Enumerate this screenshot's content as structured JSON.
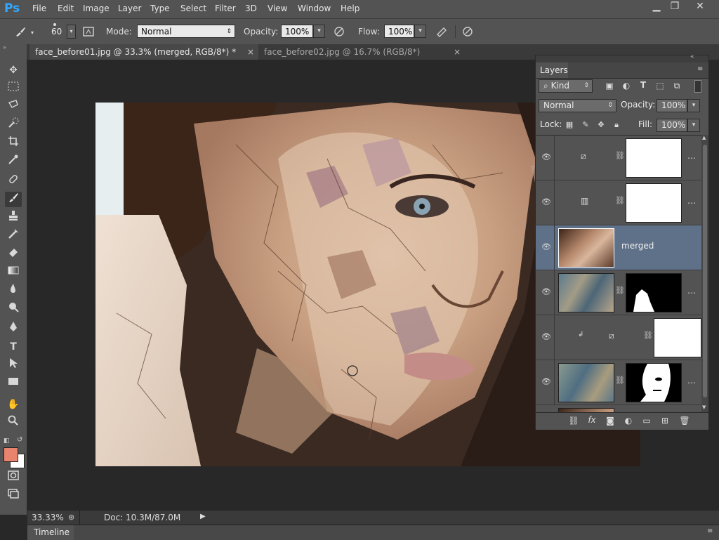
{
  "app": {
    "logo": "Ps"
  },
  "menu": [
    "File",
    "Edit",
    "Image",
    "Layer",
    "Type",
    "Select",
    "Filter",
    "3D",
    "View",
    "Window",
    "Help"
  ],
  "window_controls": {
    "minimize": "▁",
    "restore": "❐",
    "close": "✕"
  },
  "options": {
    "brush_size": "60",
    "mode_label": "Mode:",
    "mode_value": "Normal",
    "opacity_label": "Opacity:",
    "opacity_value": "100%",
    "flow_label": "Flow:",
    "flow_value": "100%"
  },
  "tabs": [
    {
      "label": "face_before01.jpg @ 33.3% (merged, RGB/8*) *",
      "close": "×",
      "active": true
    },
    {
      "label": "face_before02.jpg @ 16.7% (RGB/8*)",
      "close": "×",
      "active": false
    }
  ],
  "status": {
    "zoom": "33.33%",
    "doc": "Doc: 10.3M/87.0M"
  },
  "timeline": {
    "label": "Timeline"
  },
  "layers_panel": {
    "title": "Layers",
    "kind_label": "Kind",
    "blend_mode": "Normal",
    "opacity_label": "Opacity:",
    "opacity_value": "100%",
    "lock_label": "Lock:",
    "fill_label": "Fill:",
    "fill_value": "100%",
    "layers": [
      {
        "name": "",
        "type": "adjustment-curves",
        "visible": true
      },
      {
        "name": "",
        "type": "adjustment-levels",
        "visible": true
      },
      {
        "name": "merged",
        "type": "pixel",
        "visible": true,
        "selected": true
      },
      {
        "name": "",
        "type": "texture-masked",
        "visible": true
      },
      {
        "name": "",
        "type": "adjustment-clipped",
        "visible": true
      },
      {
        "name": "",
        "type": "texture-face-mask",
        "visible": true
      },
      {
        "name": "",
        "type": "pixel-partial",
        "visible": true
      }
    ]
  },
  "colors": {
    "foreground": "#e8836d",
    "background": "#ffffff",
    "selection": "#5f7188"
  }
}
